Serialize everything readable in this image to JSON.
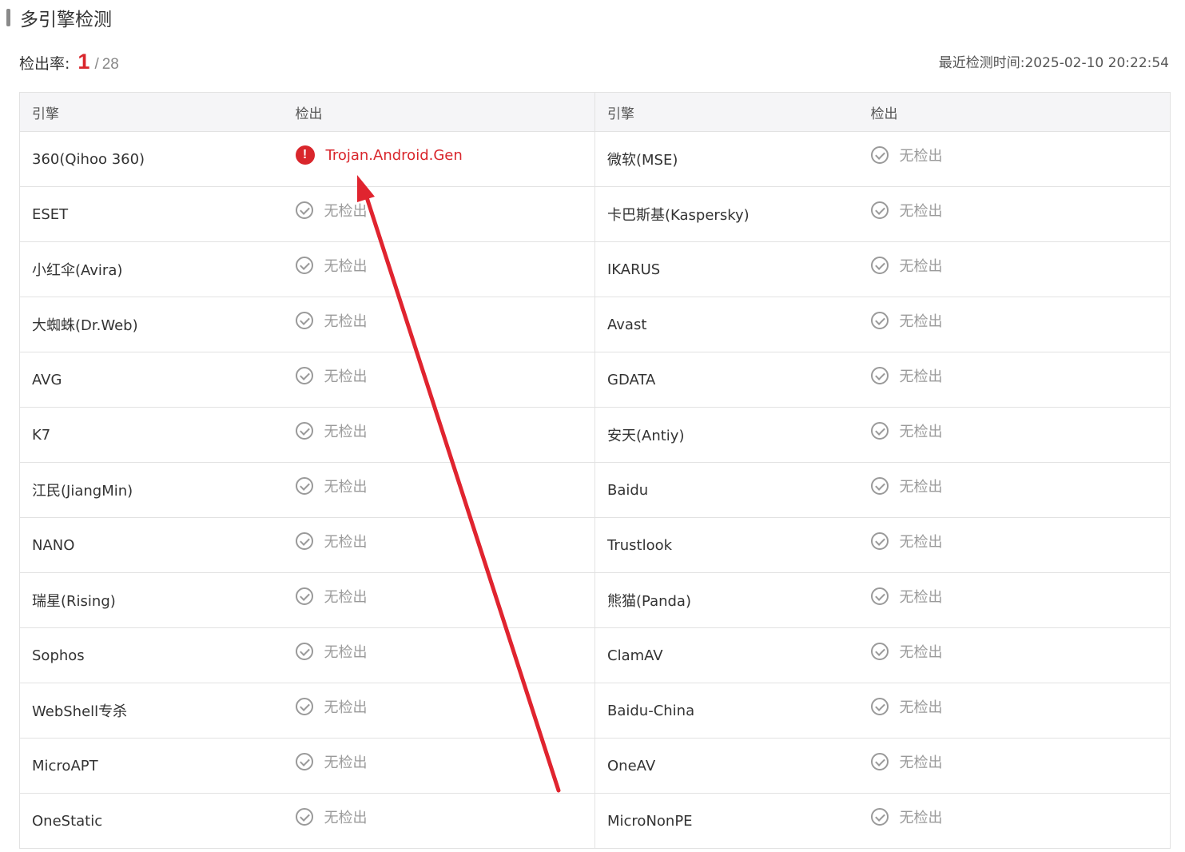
{
  "section": {
    "title": "多引擎检测"
  },
  "summary": {
    "rate_label": "检出率:",
    "detected_count": "1",
    "separator": "/",
    "total_engines": "28",
    "scan_time_label": "最近检测时间:",
    "scan_time": "2025-02-10 20:22:54"
  },
  "table": {
    "headers": [
      "引擎",
      "检出",
      "引擎",
      "检出"
    ],
    "rows": [
      {
        "left_engine": "360(Qihoo 360)",
        "left_result": "Trojan.Android.Gen",
        "left_status": "detected",
        "right_engine": "微软(MSE)",
        "right_result": "无检出",
        "right_status": "clean"
      },
      {
        "left_engine": "ESET",
        "left_result": "无检出",
        "left_status": "clean",
        "right_engine": "卡巴斯基(Kaspersky)",
        "right_result": "无检出",
        "right_status": "clean"
      },
      {
        "left_engine": "小红伞(Avira)",
        "left_result": "无检出",
        "left_status": "clean",
        "right_engine": "IKARUS",
        "right_result": "无检出",
        "right_status": "clean"
      },
      {
        "left_engine": "大蜘蛛(Dr.Web)",
        "left_result": "无检出",
        "left_status": "clean",
        "right_engine": "Avast",
        "right_result": "无检出",
        "right_status": "clean"
      },
      {
        "left_engine": "AVG",
        "left_result": "无检出",
        "left_status": "clean",
        "right_engine": "GDATA",
        "right_result": "无检出",
        "right_status": "clean"
      },
      {
        "left_engine": "K7",
        "left_result": "无检出",
        "left_status": "clean",
        "right_engine": "安天(Antiy)",
        "right_result": "无检出",
        "right_status": "clean"
      },
      {
        "left_engine": "江民(JiangMin)",
        "left_result": "无检出",
        "left_status": "clean",
        "right_engine": "Baidu",
        "right_result": "无检出",
        "right_status": "clean"
      },
      {
        "left_engine": "NANO",
        "left_result": "无检出",
        "left_status": "clean",
        "right_engine": "Trustlook",
        "right_result": "无检出",
        "right_status": "clean"
      },
      {
        "left_engine": "瑞星(Rising)",
        "left_result": "无检出",
        "left_status": "clean",
        "right_engine": "熊猫(Panda)",
        "right_result": "无检出",
        "right_status": "clean"
      },
      {
        "left_engine": "Sophos",
        "left_result": "无检出",
        "left_status": "clean",
        "right_engine": "ClamAV",
        "right_result": "无检出",
        "right_status": "clean"
      },
      {
        "left_engine": "WebShell专杀",
        "left_result": "无检出",
        "left_status": "clean",
        "right_engine": "Baidu-China",
        "right_result": "无检出",
        "right_status": "clean"
      },
      {
        "left_engine": "MicroAPT",
        "left_result": "无检出",
        "left_status": "clean",
        "right_engine": "OneAV",
        "right_result": "无检出",
        "right_status": "clean"
      },
      {
        "left_engine": "OneStatic",
        "left_result": "无检出",
        "left_status": "clean",
        "right_engine": "MicroNonPE",
        "right_result": "无检出",
        "right_status": "clean"
      }
    ]
  },
  "icons": {
    "clean": "check-circle-icon",
    "detected": "alert-circle-icon"
  },
  "colors": {
    "detected": "#d9262c",
    "clean": "#9a9a9a",
    "annotation_arrow": "#e0242f"
  }
}
